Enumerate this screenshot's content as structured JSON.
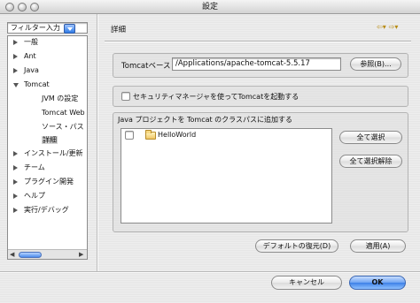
{
  "window": {
    "title": "設定"
  },
  "filter": {
    "value": "フィルター入力"
  },
  "tree": {
    "items": [
      {
        "label": "一般",
        "expander": "right"
      },
      {
        "label": "Ant",
        "expander": "right"
      },
      {
        "label": "Java",
        "expander": "right"
      },
      {
        "label": "Tomcat",
        "expander": "down"
      },
      {
        "label": "JVM の設定",
        "expander": "none"
      },
      {
        "label": "Tomcat Web",
        "expander": "none"
      },
      {
        "label": "ソース・パス",
        "expander": "none"
      },
      {
        "label": "詳細",
        "expander": "none",
        "selected": true
      },
      {
        "label": "インストール/更新",
        "expander": "right"
      },
      {
        "label": "チーム",
        "expander": "right"
      },
      {
        "label": "プラグイン開発",
        "expander": "right"
      },
      {
        "label": "ヘルプ",
        "expander": "right"
      },
      {
        "label": "実行/デバッグ",
        "expander": "right"
      }
    ]
  },
  "page": {
    "title": "詳細"
  },
  "tomcat_base": {
    "label": "Tomcatベース",
    "value": "/Applications/apache-tomcat-5.5.17",
    "browse_label": "参照(B)..."
  },
  "security": {
    "label": "セキュリティマネージャを使ってTomcatを起動する",
    "checked": false
  },
  "classpath": {
    "title": "Java プロジェクトを Tomcat のクラスパスに追加する",
    "projects": [
      {
        "name": "HelloWorld",
        "checked": false
      }
    ],
    "select_all_label": "全て選択",
    "deselect_all_label": "全て選択解除"
  },
  "actions": {
    "restore_defaults_label": "デフォルトの復元(D)",
    "apply_label": "適用(A)"
  },
  "footer": {
    "cancel_label": "キャンセル",
    "ok_label": "OK"
  },
  "colors": {
    "accent": "#3d80e7",
    "selection_bg": "#d4d4d4",
    "nav_arrow": "#b78a10"
  }
}
